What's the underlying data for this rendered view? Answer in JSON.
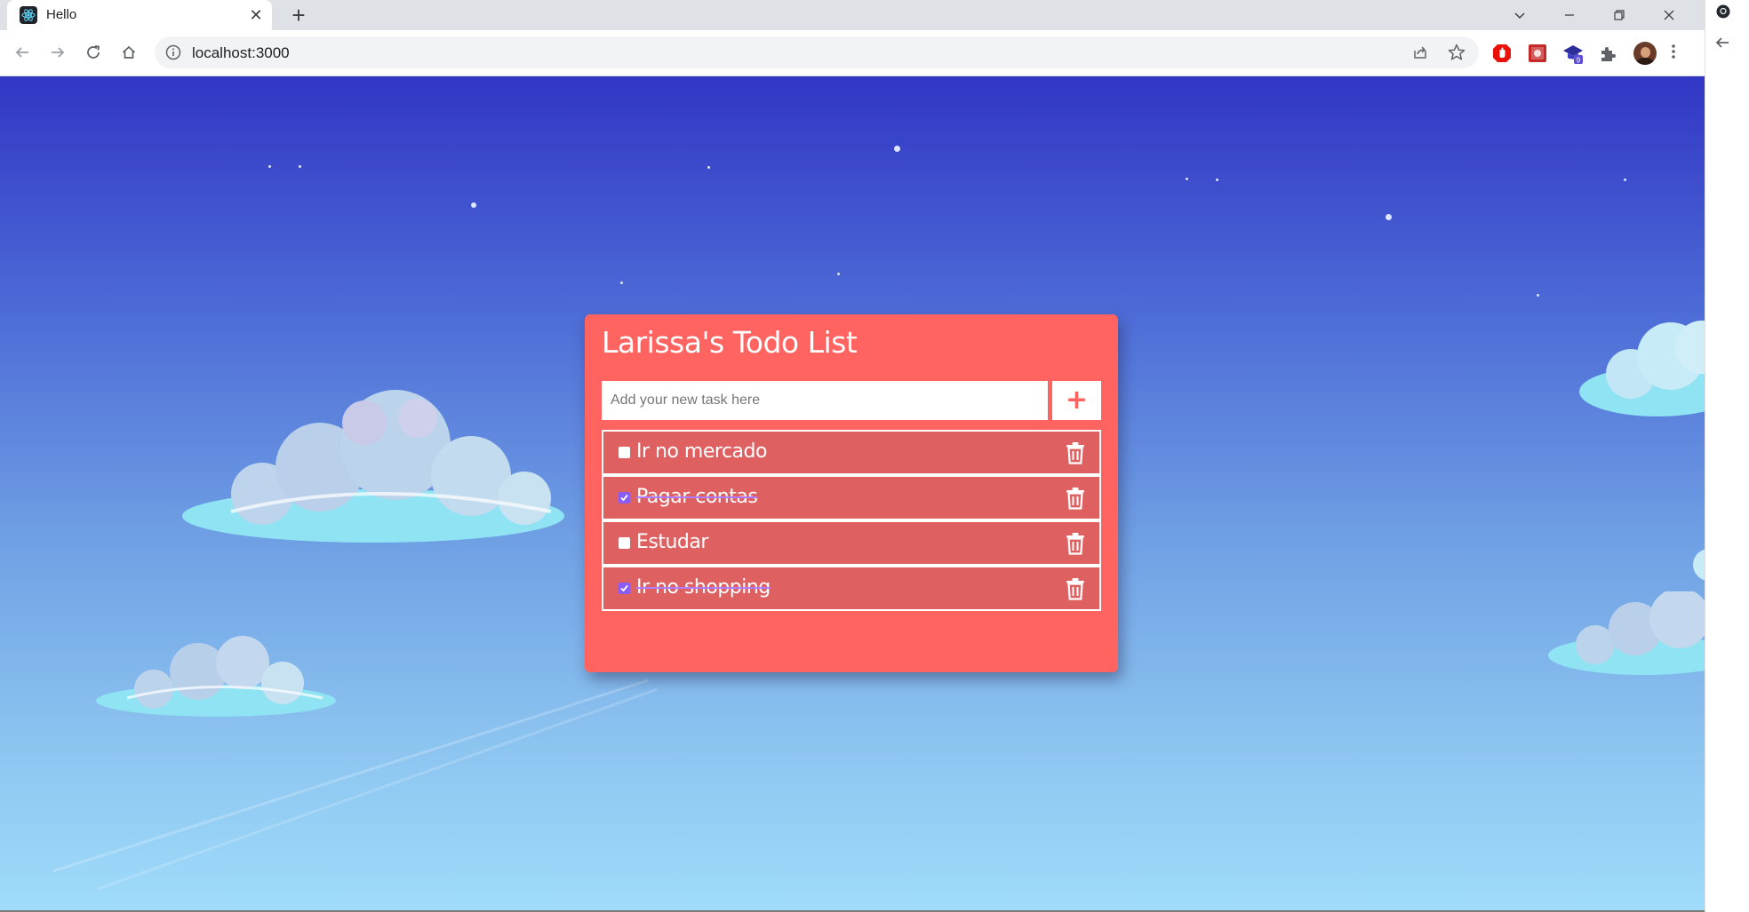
{
  "browser": {
    "tab_title": "Hello",
    "url": "localhost:3000"
  },
  "todo": {
    "title": "Larissa's Todo List",
    "input_placeholder": "Add your new task here",
    "add_button_symbol": "+",
    "items": [
      {
        "text": "Ir no mercado",
        "done": false
      },
      {
        "text": "Pagar contas",
        "done": true
      },
      {
        "text": "Estudar",
        "done": false
      },
      {
        "text": "Ir no shopping",
        "done": true
      }
    ]
  },
  "colors": {
    "card": "#ff6461",
    "item": "#df6061",
    "checkbox_checked": "#8a5cf6",
    "sky_top": "#3136c4",
    "sky_bottom": "#a0dcfa"
  }
}
